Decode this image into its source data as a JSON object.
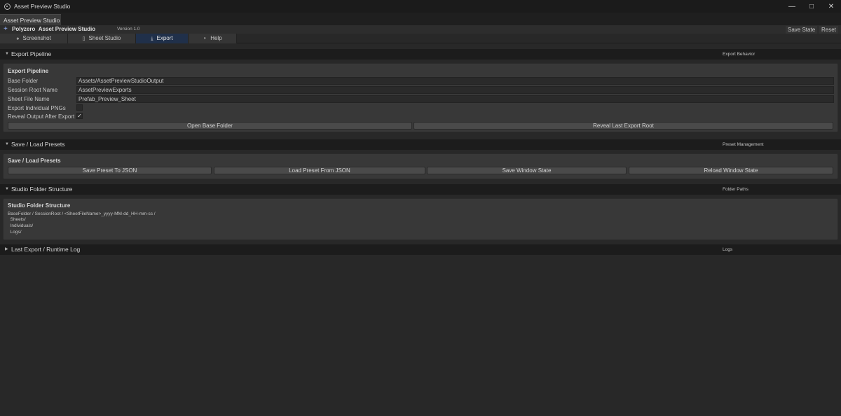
{
  "window": {
    "title": "Asset Preview Studio"
  },
  "doc_tab": {
    "label": "Asset Preview Studio"
  },
  "toolbar": {
    "brand": "Polyzero",
    "product": "Asset Preview Studio",
    "version": "Version 1.0",
    "save_state_label": "Save State",
    "reset_label": "Reset"
  },
  "tabs": [
    {
      "label": "Screenshot",
      "icon": "camera-icon"
    },
    {
      "label": "Sheet Studio",
      "icon": "sheet-icon"
    },
    {
      "label": "Export",
      "icon": "export-icon",
      "active": true
    },
    {
      "label": "Help",
      "icon": "help-icon"
    }
  ],
  "sections": {
    "export_pipeline": {
      "header": "Export Pipeline",
      "header_right": "Export Behavior",
      "panel_title": "Export Pipeline",
      "fields": {
        "base_folder": {
          "label": "Base Folder",
          "value": "Assets/AssetPreviewStudioOutput"
        },
        "session_root": {
          "label": "Session Root Name",
          "value": "AssetPreviewExports"
        },
        "sheet_file": {
          "label": "Sheet File Name",
          "value": "Prefab_Preview_Sheet"
        },
        "export_individual": {
          "label": "Export Individual PNGs",
          "checked": ""
        },
        "reveal_output": {
          "label": "Reveal Output After Export",
          "checked": "✓"
        }
      },
      "buttons": {
        "open_base": "Open Base Folder",
        "reveal_last": "Reveal Last Export Root"
      }
    },
    "presets": {
      "header": "Save / Load Presets",
      "header_right": "Preset Management",
      "panel_title": "Save / Load Presets",
      "buttons": {
        "save_preset": "Save Preset To JSON",
        "load_preset": "Load Preset From JSON",
        "save_window": "Save Window State",
        "reload_window": "Reload Window State"
      }
    },
    "folder_structure": {
      "header": "Studio Folder Structure",
      "header_right": "Folder Paths",
      "panel_title": "Studio Folder Structure",
      "lines": [
        "BaseFolder / SessionRoot / <SheetFileName>_yyyy-MM-dd_HH-mm-ss /",
        "  Sheets/",
        "  Individuals/",
        "  Logs/"
      ]
    },
    "log": {
      "header": "Last Export / Runtime Log",
      "header_right": "Logs"
    }
  }
}
